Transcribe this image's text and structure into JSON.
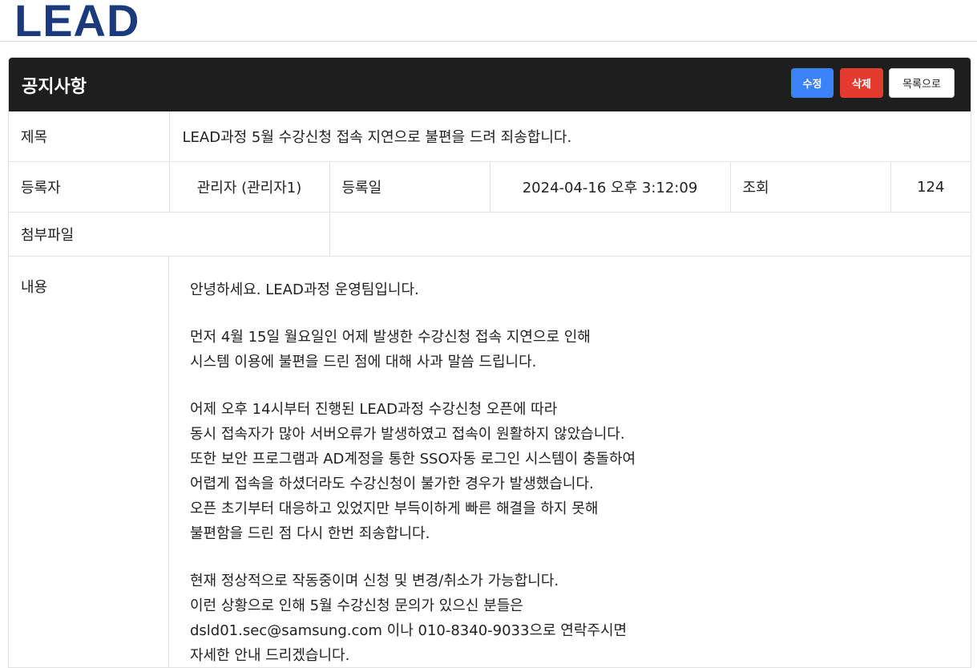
{
  "logo": "LEAD",
  "header": {
    "title": "공지사항",
    "edit_label": "수정",
    "delete_label": "삭제",
    "list_label": "목록으로"
  },
  "colors": {
    "brand": "#1a3a7c",
    "header_bg": "#1e1e1e",
    "edit": "#3b82f6",
    "delete": "#e53b2f"
  },
  "fields": {
    "title_label": "제목",
    "title_value": "LEAD과정 5월 수강신청 접속 지연으로 불편을 드려 죄송합니다.",
    "author_label": "등록자",
    "author_value": "관리자 (관리자1)",
    "date_label": "등록일",
    "date_value": "2024-04-16 오후 3:12:09",
    "views_label": "조회",
    "views_value": "124",
    "attachment_label": "첨부파일",
    "attachment_value": "",
    "content_label": "내용"
  },
  "content": {
    "p1": [
      "안녕하세요. LEAD과정 운영팀입니다."
    ],
    "p2": [
      "먼저 4월 15일 월요일인 어제 발생한 수강신청 접속 지연으로 인해",
      "시스템 이용에 불편을 드린 점에 대해 사과 말씀 드립니다."
    ],
    "p3": [
      "어제 오후 14시부터 진행된 LEAD과정 수강신청 오픈에 따라",
      "동시 접속자가 많아 서버오류가 발생하였고 접속이 원활하지 않았습니다.",
      "또한 보안 프로그램과 AD계정을 통한 SSO자동 로그인 시스템이 충돌하여",
      "어렵게 접속을 하셨더라도 수강신청이 불가한 경우가 발생했습니다.",
      "오픈 초기부터 대응하고 있었지만 부득이하게 빠른 해결을 하지 못해",
      "불편함을 드린 점 다시 한번 죄송합니다."
    ],
    "p4": [
      "현재 정상적으로 작동중이며 신청 및 변경/취소가 가능합니다.",
      "이런 상황으로 인해 5월 수강신청 문의가 있으신 분들은",
      "dsld01.sec@samsung.com 이나 010-8340-9033으로 연락주시면",
      "자세한 안내 드리겠습니다."
    ]
  }
}
